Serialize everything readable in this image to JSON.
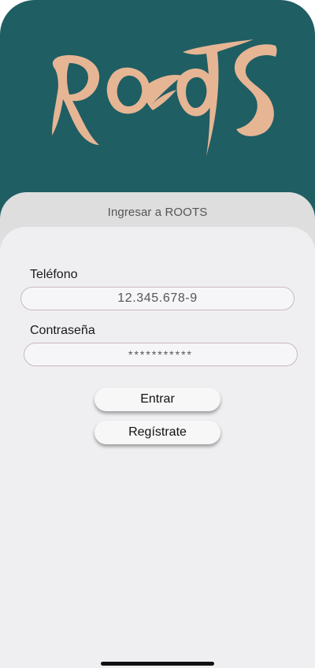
{
  "colors": {
    "brand_teal": "#1f5e63",
    "logo_peach": "#e6b594",
    "sheet_gray": "#dedede",
    "card_bg": "#efeff1"
  },
  "logo": {
    "text": "ROOTS",
    "icon": "roots-logo"
  },
  "header": {
    "title": "Ingresar a ROOTS"
  },
  "form": {
    "phone": {
      "label": "Teléfono",
      "value": "12.345.678-9"
    },
    "password": {
      "label": "Contraseña",
      "value": "***********"
    }
  },
  "actions": {
    "login_label": "Entrar",
    "register_label": "Regístrate"
  }
}
